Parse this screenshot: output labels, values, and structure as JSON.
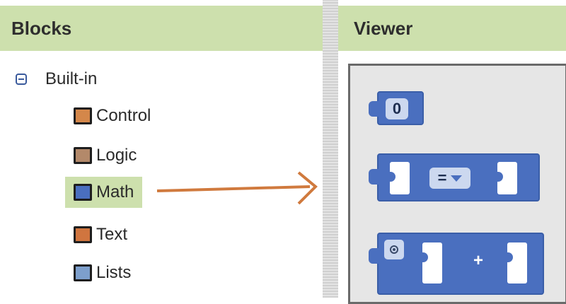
{
  "blocks_panel": {
    "title": "Blocks"
  },
  "viewer_panel": {
    "title": "Viewer"
  },
  "tree": {
    "root_label": "Built-in",
    "items": [
      {
        "label": "Control",
        "color": "#d4874a"
      },
      {
        "label": "Logic",
        "color": "#b3896a"
      },
      {
        "label": "Math",
        "color": "#4a6fbf",
        "selected": true
      },
      {
        "label": "Text",
        "color": "#d0753f"
      },
      {
        "label": "Lists",
        "color": "#7d9fcc"
      }
    ]
  },
  "viewer_blocks": {
    "number_value": "0",
    "compare_operator": "=",
    "add_operator": "+"
  },
  "colors": {
    "header_bg": "#cde0ad",
    "selection_bg": "#cde0ad",
    "math_block": "#4a6fbf",
    "arrow": "#d07a3e"
  }
}
